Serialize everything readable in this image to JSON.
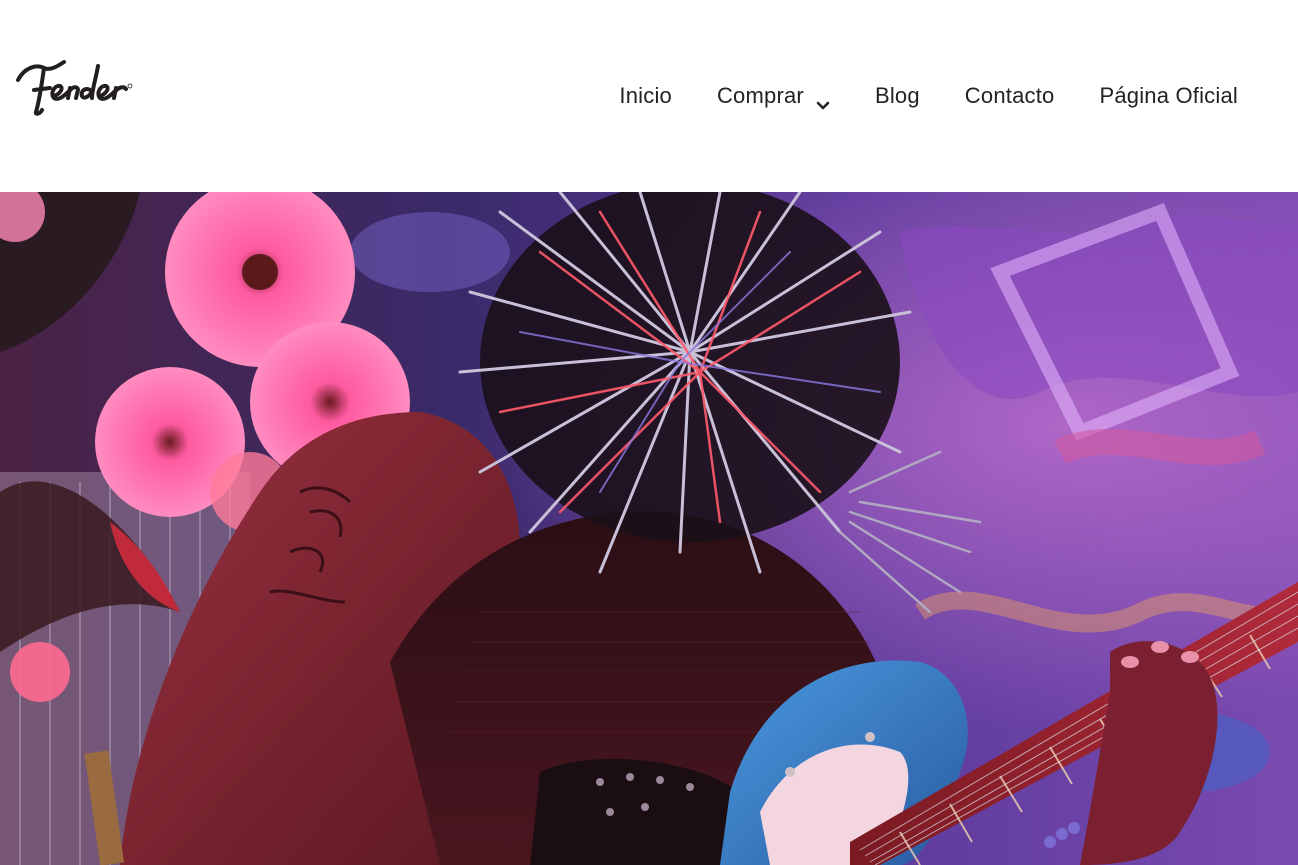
{
  "brand": {
    "logo_text": "Fender",
    "logo_color": "#231f20"
  },
  "nav": {
    "items": [
      {
        "label": "Inicio"
      },
      {
        "label": "Comprar",
        "has_dropdown": true,
        "icon": "chevron-down-icon"
      },
      {
        "label": "Blog"
      },
      {
        "label": "Contacto"
      },
      {
        "label": "Página Oficial"
      }
    ],
    "text_color": "#222222"
  },
  "hero": {
    "image_subject": "hero-photo",
    "palette": [
      "#3a1a4a",
      "#7a3aa8",
      "#e0508a",
      "#ff6fa8",
      "#3f8fd6",
      "#8b1f2a"
    ]
  }
}
